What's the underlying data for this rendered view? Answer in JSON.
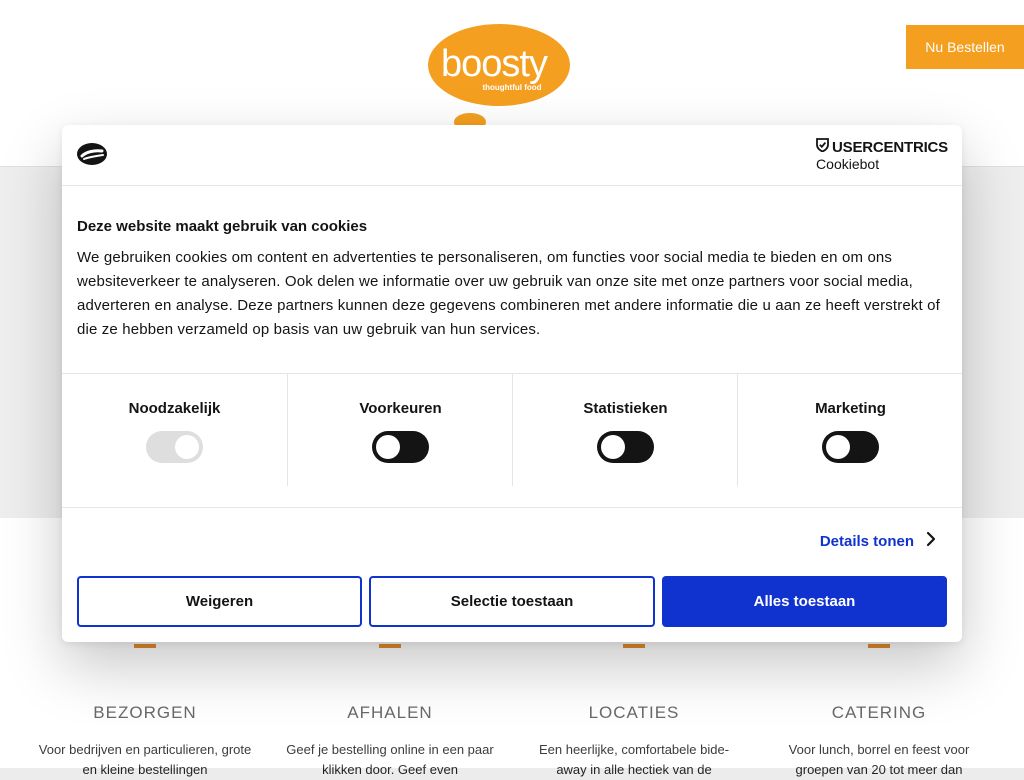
{
  "header": {
    "logo_text": "boosty",
    "logo_tagline": "thoughtful food",
    "cta_label": "Nu Bestellen"
  },
  "services": [
    {
      "title": "BEZORGEN",
      "description": "Voor bedrijven en particulieren, grote en kleine bestellingen"
    },
    {
      "title": "AFHALEN",
      "description": "Geef je bestelling online in een paar klikken door. Geef even"
    },
    {
      "title": "LOCATIES",
      "description": "Een heerlijke, comfortabele bide-away in alle hectiek van de"
    },
    {
      "title": "CATERING",
      "description": "Voor lunch, borrel en feest voor groepen van 20 tot meer dan"
    }
  ],
  "cookie_dialog": {
    "brand_name": "USERCENTRICS",
    "brand_product": "Cookiebot",
    "title": "Deze website maakt gebruik van cookies",
    "body": "We gebruiken cookies om content en advertenties te personaliseren, om functies voor social media te bieden en om ons websiteverkeer te analyseren. Ook delen we informatie over uw gebruik van onze site met onze partners voor social media, adverteren en analyse. Deze partners kunnen deze gegevens combineren met andere informatie die u aan ze heeft verstrekt of die ze hebben verzameld op basis van uw gebruik van hun services.",
    "categories": [
      {
        "label": "Noodzakelijk",
        "checked": true,
        "disabled": true
      },
      {
        "label": "Voorkeuren",
        "checked": false,
        "disabled": false
      },
      {
        "label": "Statistieken",
        "checked": false,
        "disabled": false
      },
      {
        "label": "Marketing",
        "checked": false,
        "disabled": false
      }
    ],
    "details_label": "Details tonen",
    "buttons": {
      "deny": "Weigeren",
      "allow_selection": "Selectie toestaan",
      "allow_all": "Alles toestaan"
    }
  },
  "colors": {
    "brand_orange": "#f39200",
    "accent_blue": "#1032cf",
    "toggle_off": "#141414",
    "toggle_disabled": "#dedede"
  }
}
